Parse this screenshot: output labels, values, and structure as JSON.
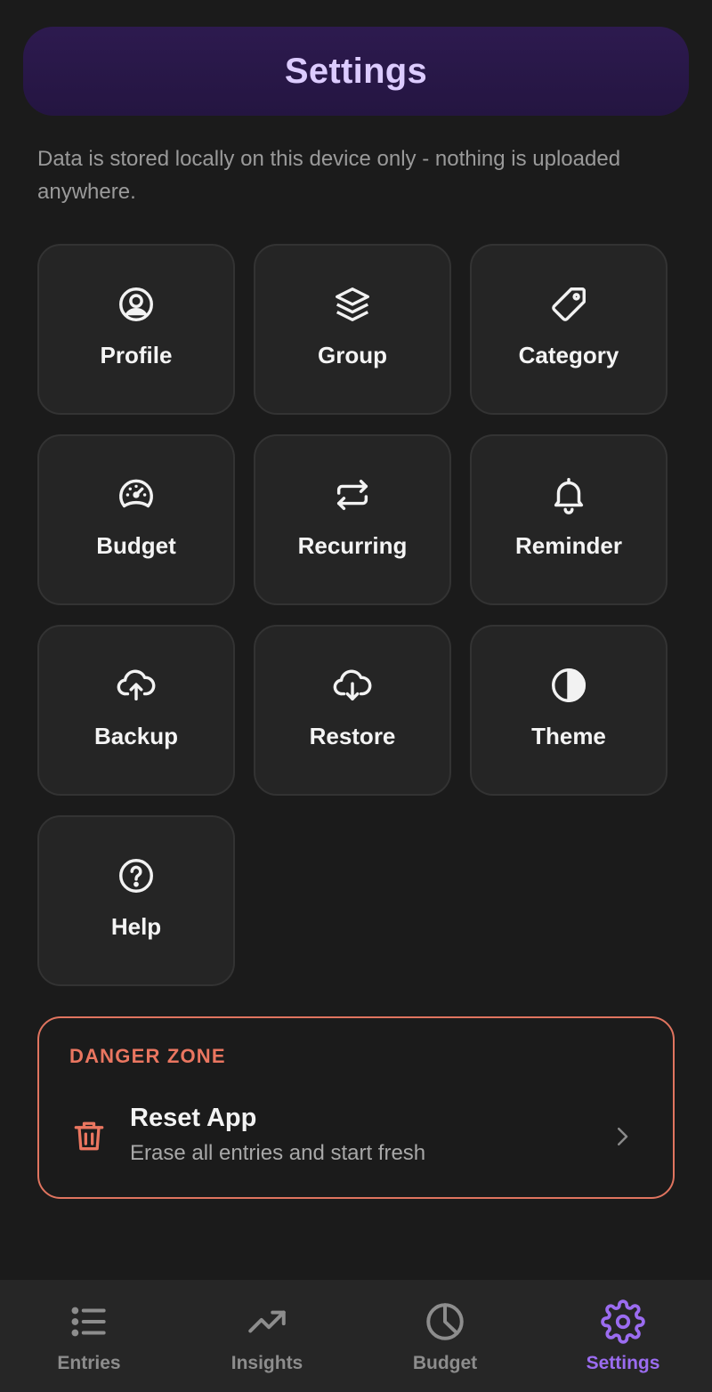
{
  "header": {
    "title": "Settings"
  },
  "notice": "Data is stored locally on this device only - nothing is uploaded anywhere.",
  "tiles": [
    {
      "label": "Profile",
      "icon": "user-circle-icon"
    },
    {
      "label": "Group",
      "icon": "stack-icon"
    },
    {
      "label": "Category",
      "icon": "tag-icon"
    },
    {
      "label": "Budget",
      "icon": "gauge-icon"
    },
    {
      "label": "Recurring",
      "icon": "repeat-icon"
    },
    {
      "label": "Reminder",
      "icon": "bell-icon"
    },
    {
      "label": "Backup",
      "icon": "cloud-upload-icon"
    },
    {
      "label": "Restore",
      "icon": "cloud-download-icon"
    },
    {
      "label": "Theme",
      "icon": "contrast-icon"
    },
    {
      "label": "Help",
      "icon": "help-circle-icon"
    }
  ],
  "danger": {
    "title": "DANGER ZONE",
    "item_title": "Reset App",
    "item_subtitle": "Erase all entries and start fresh",
    "color": "#ea7660"
  },
  "nav": [
    {
      "label": "Entries",
      "icon": "list-icon",
      "active": false
    },
    {
      "label": "Insights",
      "icon": "trend-up-icon",
      "active": false
    },
    {
      "label": "Budget",
      "icon": "pie-icon",
      "active": false
    },
    {
      "label": "Settings",
      "icon": "gear-icon",
      "active": true
    }
  ],
  "colors": {
    "accent": "#9b6cf0",
    "background": "#1b1b1b",
    "tile": "#252525"
  }
}
